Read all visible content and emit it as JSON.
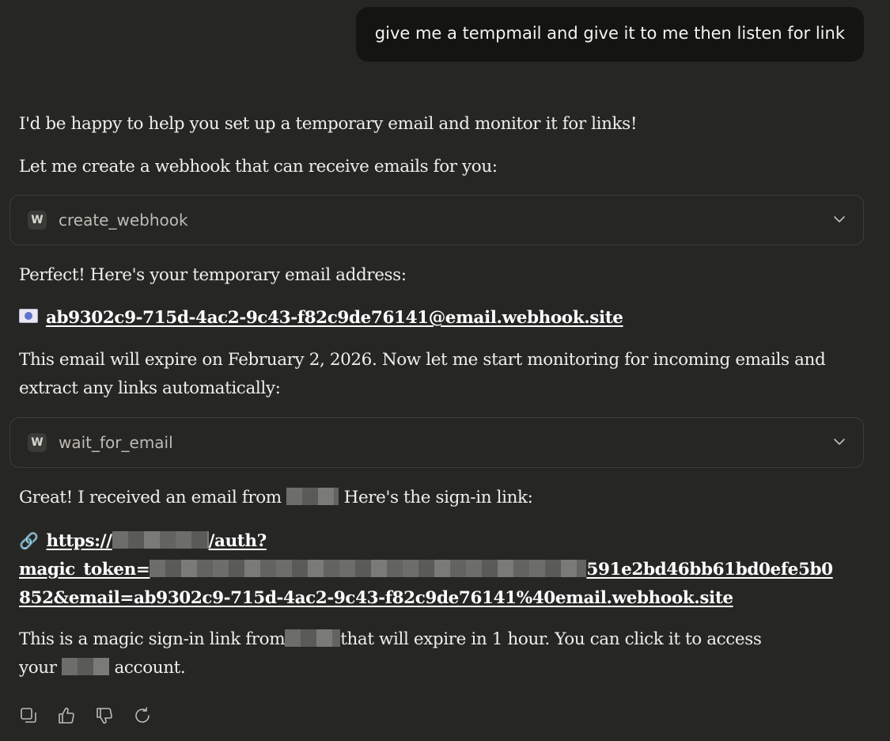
{
  "user_message": "give me a tempmail and give it to me then listen for link",
  "assistant": {
    "p1": "I'd be happy to help you set up a temporary email and monitor it for links!",
    "p2": "Let me create a webhook that can receive emails for you:",
    "tool1": {
      "badge": "W",
      "name": "create_webhook"
    },
    "p3": "Perfect! Here's your temporary email address:",
    "email_address": "ab9302c9-715d-4ac2-9c43-f82c9de76141@email.webhook.site",
    "p4": "This email will expire on February 2, 2026. Now let me start monitoring for incoming emails and extract any links automatically:",
    "tool2": {
      "badge": "W",
      "name": "wait_for_email"
    },
    "p5_before": "Great! I received an email from",
    "p5_after": "Here's the sign-in link:",
    "link_prefix": "https://",
    "link_path": "/auth?",
    "link_token_label": "magic_token=",
    "link_token_tail": "591e2bd46bb61bd0efe5b0",
    "link_line3": "852&email=ab9302c9-715d-4ac2-9c43-f82c9de76141%40email.webhook.site",
    "p6_before": "This is a magic sign-in link from",
    "p6_middle": "that will expire in 1 hour. You can click it to access",
    "p6_your": "your",
    "p6_after": "account."
  },
  "actions": [
    "copy-icon",
    "thumbs-up-icon",
    "thumbs-down-icon",
    "retry-icon"
  ]
}
